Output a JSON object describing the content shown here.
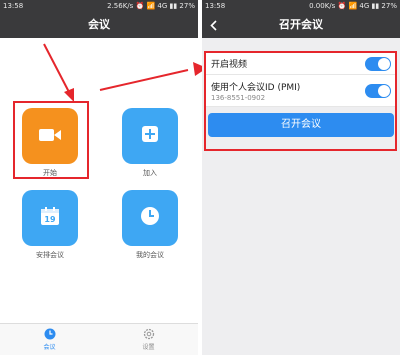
{
  "left_screen": {
    "status": {
      "time": "13:58",
      "info": "2.56K/s ⏰ 📶 4G ▮▮ 27%"
    },
    "title": "会议",
    "tiles": [
      {
        "label": "开始",
        "icon": "video-camera-icon",
        "color": "#f5911e"
      },
      {
        "label": "加入",
        "icon": "plus-icon",
        "color": "#3ea7f3"
      },
      {
        "label": "安排会议",
        "icon": "calendar-icon",
        "color": "#3ea7f3",
        "calendar_day": "19"
      },
      {
        "label": "我的会议",
        "icon": "clock-icon",
        "color": "#3ea7f3"
      }
    ],
    "tabs": [
      {
        "label": "会议",
        "icon": "clock-icon",
        "active": true
      },
      {
        "label": "设置",
        "icon": "gear-icon",
        "active": false
      }
    ]
  },
  "right_screen": {
    "status": {
      "time": "13:58",
      "info": "0.00K/s ⏰ 📶 4G ▮▮ 27%"
    },
    "title": "召开会议",
    "video_toggle": {
      "label": "开启视频",
      "on": true
    },
    "pmi_toggle": {
      "label": "使用个人会议ID (PMI)",
      "sub": "136-8551-0902",
      "on": true
    },
    "start_button": "召开会议"
  },
  "colors": {
    "accent": "#2d8cf0",
    "highlight": "#e5262c",
    "tile_orange": "#f5911e",
    "tile_blue": "#3ea7f3",
    "navbar": "#3a3a3c"
  }
}
